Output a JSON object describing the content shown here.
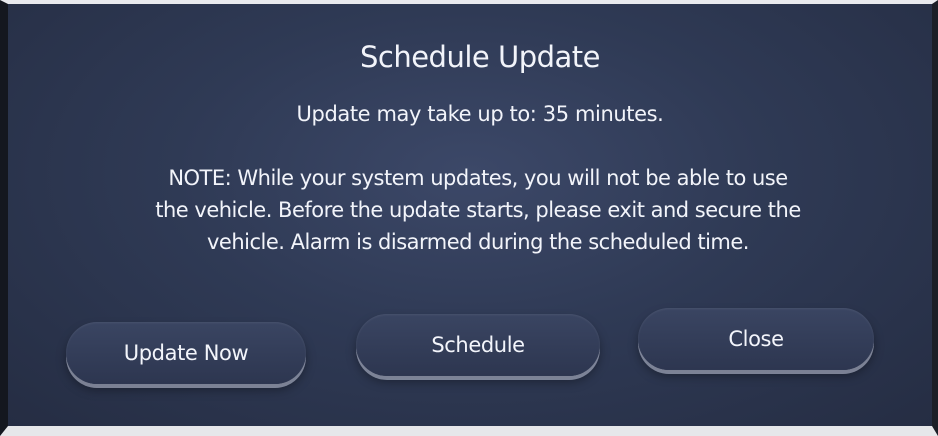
{
  "dialog": {
    "title": "Schedule Update",
    "duration_text": "Update may take up to: 35 minutes.",
    "note_lines": [
      "NOTE: While your system updates, you will not be able to use",
      "the vehicle. Before the update starts, please exit and secure the",
      "vehicle. Alarm is disarmed during the scheduled time."
    ]
  },
  "buttons": {
    "update_now": "Update Now",
    "schedule": "Schedule",
    "close": "Close"
  }
}
